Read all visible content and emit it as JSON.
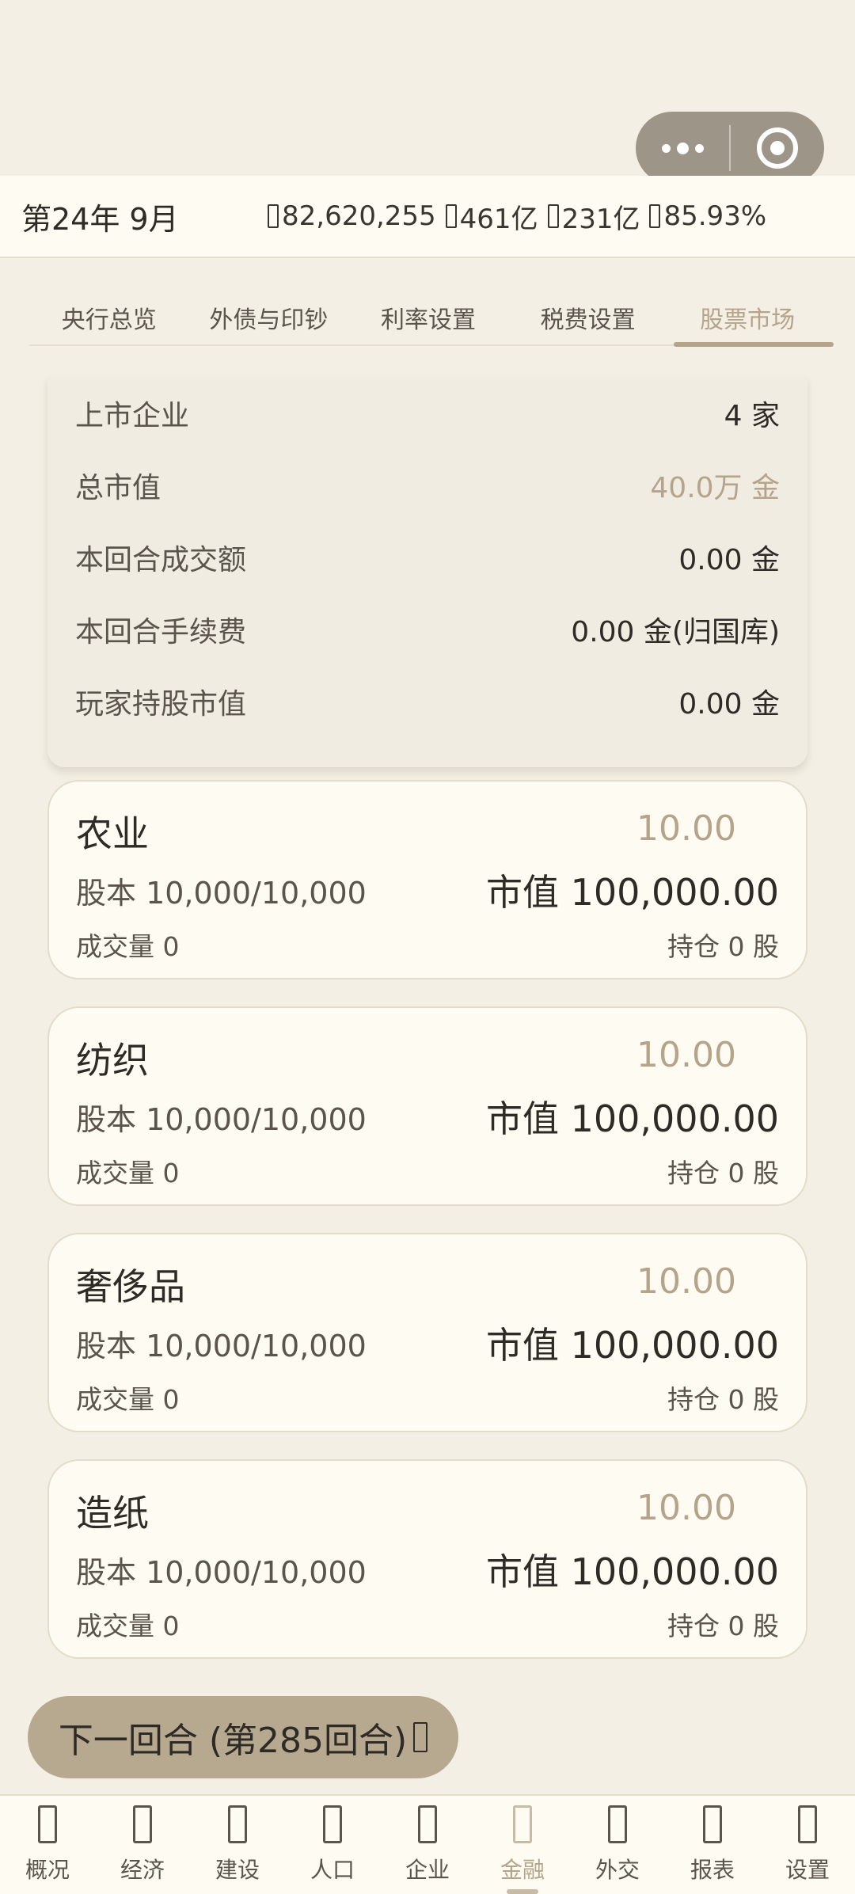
{
  "status": {
    "date": "第24年 9月",
    "stats": [
      {
        "icon": "coin-icon",
        "value": "82,620,255"
      },
      {
        "icon": "gdp-icon",
        "value": "461亿"
      },
      {
        "icon": "reserve-icon",
        "value": "231亿"
      },
      {
        "icon": "approval-icon",
        "value": "85.93%"
      }
    ]
  },
  "tabs": [
    "央行总览",
    "外债与印钞",
    "利率设置",
    "税费设置",
    "股票市场"
  ],
  "active_tab": "股票市场",
  "summary": [
    {
      "label": "上市企业",
      "value": "4 家"
    },
    {
      "label": "总市值",
      "value": "40.0万 金"
    },
    {
      "label": "本回合成交额",
      "value": "0.00 金"
    },
    {
      "label": "本回合手续费",
      "value": "0.00 金(归国库)"
    },
    {
      "label": "玩家持股市值",
      "value": "0.00 金"
    }
  ],
  "stocks": [
    {
      "name": "农业",
      "price": "10.00",
      "equity": "股本 10,000/10,000",
      "market_cap": "市值 100,000.00",
      "volume": "成交量 0",
      "holding": "持仓 0 股"
    },
    {
      "name": "纺织",
      "price": "10.00",
      "equity": "股本 10,000/10,000",
      "market_cap": "市值 100,000.00",
      "volume": "成交量 0",
      "holding": "持仓 0 股"
    },
    {
      "name": "奢侈品",
      "price": "10.00",
      "equity": "股本 10,000/10,000",
      "market_cap": "市值 100,000.00",
      "volume": "成交量 0",
      "holding": "持仓 0 股"
    },
    {
      "name": "造纸",
      "price": "10.00",
      "equity": "股本 10,000/10,000",
      "market_cap": "市值 100,000.00",
      "volume": "成交量 0",
      "holding": "持仓 0 股"
    }
  ],
  "next_button": "下一回合 (第285回合)",
  "bottom_nav": [
    {
      "label": "概况",
      "icon": "overview-icon"
    },
    {
      "label": "经济",
      "icon": "economy-icon"
    },
    {
      "label": "建设",
      "icon": "build-icon"
    },
    {
      "label": "人口",
      "icon": "population-icon"
    },
    {
      "label": "企业",
      "icon": "enterprise-icon"
    },
    {
      "label": "金融",
      "icon": "finance-icon"
    },
    {
      "label": "外交",
      "icon": "diplomacy-icon"
    },
    {
      "label": "报表",
      "icon": "report-icon"
    },
    {
      "label": "设置",
      "icon": "settings-icon"
    }
  ],
  "active_nav": "金融",
  "colors": {
    "background": "#f3efe4",
    "card": "#fdfbf2",
    "accent": "#b5a48a",
    "button": "#b6a98f",
    "capsule": "#9c9588"
  }
}
